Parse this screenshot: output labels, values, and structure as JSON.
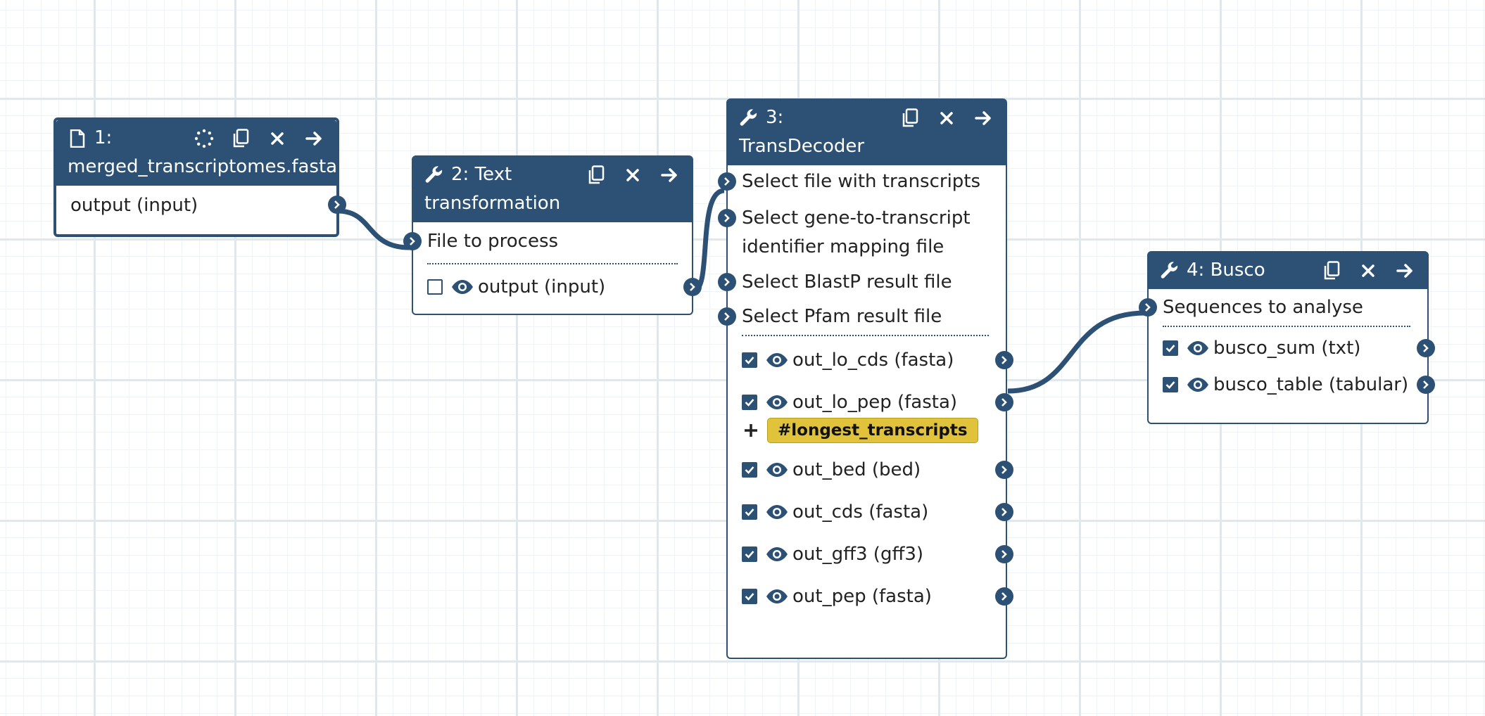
{
  "nodes": {
    "n1": {
      "step": "1:",
      "name": "merged_transcriptomes.fasta",
      "icon": "file-icon",
      "outputs": [
        "output (input)"
      ]
    },
    "n2": {
      "title_line1": "2: Text",
      "title_line2": "transformation",
      "icon": "wrench-icon",
      "inputs": [
        "File to process"
      ],
      "outputs": [
        {
          "label": "output (input)",
          "checked": false
        }
      ]
    },
    "n3": {
      "title_line1": "3:",
      "title_line2": "TransDecoder",
      "icon": "wrench-icon",
      "inputs": [
        "Select file with transcripts",
        "Select gene-to-transcript",
        "identifier mapping file",
        "Select BlastP result file",
        "Select Pfam result file"
      ],
      "outputs": [
        {
          "label": "out_lo_cds (fasta)",
          "checked": true
        },
        {
          "label": "out_lo_pep (fasta)",
          "checked": true
        },
        {
          "label": "out_bed (bed)",
          "checked": true
        },
        {
          "label": "out_cds (fasta)",
          "checked": true
        },
        {
          "label": "out_gff3 (gff3)",
          "checked": true
        },
        {
          "label": "out_pep (fasta)",
          "checked": true
        }
      ],
      "tag": "#longest_transcripts"
    },
    "n4": {
      "title": "4: Busco",
      "icon": "wrench-icon",
      "inputs": [
        "Sequences to analyse"
      ],
      "outputs": [
        {
          "label": "busco_sum (txt)",
          "checked": true
        },
        {
          "label": "busco_table (tabular)",
          "checked": true
        }
      ]
    }
  },
  "colors": {
    "node": "#2c5175",
    "tag": "#e0c23b",
    "grid_major": "#dce8f2",
    "grid_minor": "#eef3f8"
  }
}
